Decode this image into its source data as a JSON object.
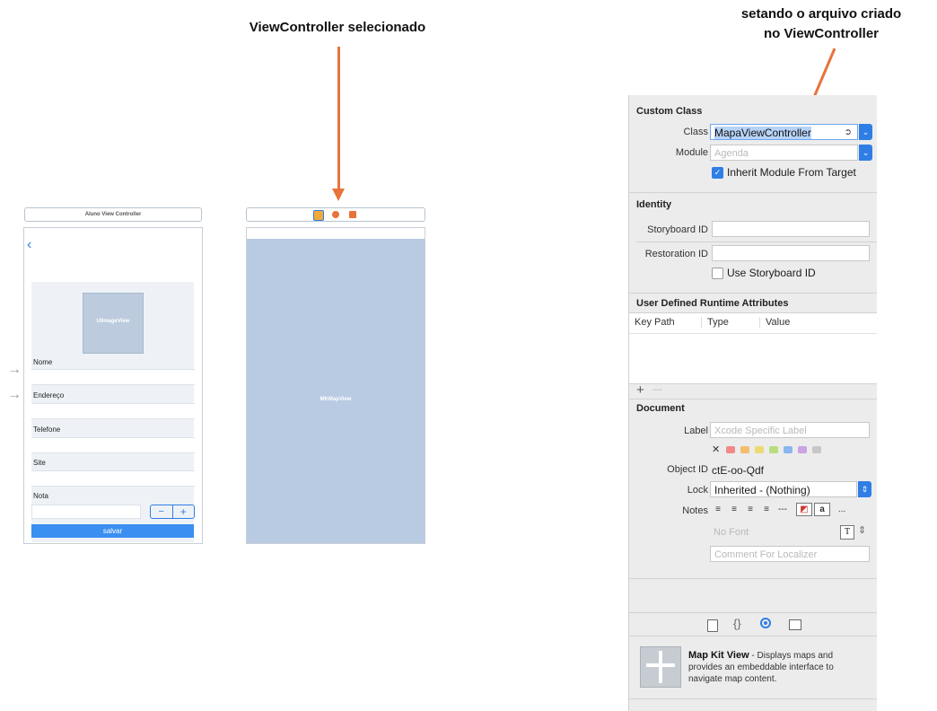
{
  "annotations": {
    "left": "ViewController selecionado",
    "right_line1": "setando o arquivo criado",
    "right_line2": "no ViewController"
  },
  "storyboard": {
    "scene1": {
      "title": "Aluno View Controller",
      "back_icon": "chevron-left-icon",
      "image_view_label": "UIImageView",
      "fields": [
        "Nome",
        "Endereço",
        "Telefone",
        "Site",
        "Nota"
      ],
      "stepper_minus": "−",
      "stepper_plus": "+",
      "save_label": "salvar"
    },
    "scene2": {
      "map_label": "MKMapView"
    }
  },
  "inspector": {
    "custom_class": {
      "header": "Custom Class",
      "class_label": "Class",
      "class_value": "MapaViewController",
      "module_label": "Module",
      "module_placeholder": "Agenda",
      "inherit_label": "Inherit Module From Target",
      "inherit_checked": true
    },
    "identity": {
      "header": "Identity",
      "storyboard_id_label": "Storyboard ID",
      "storyboard_id_value": "",
      "restoration_id_label": "Restoration ID",
      "restoration_id_value": "",
      "use_storyboard_label": "Use Storyboard ID"
    },
    "runtime_attrs": {
      "header": "User Defined Runtime Attributes",
      "columns": [
        "Key Path",
        "Type",
        "Value"
      ],
      "add": "+",
      "remove": "—"
    },
    "document": {
      "header": "Document",
      "label_label": "Label",
      "label_placeholder": "Xcode Specific Label",
      "clear_mark": "✕",
      "swatches": [
        "#f08a8a",
        "#f5bd6b",
        "#eed874",
        "#b7dd7e",
        "#8bb6ee",
        "#c9a3e3",
        "#c7c7c7"
      ],
      "object_id_label": "Object ID",
      "object_id_value": "ctE-oo-Qdf",
      "lock_label": "Lock",
      "lock_value": "Inherited - (Nothing)",
      "notes_label": "Notes",
      "notes_toolbar": [
        "≡",
        "≡",
        "≡",
        "≡",
        "---",
        "◩",
        "a",
        "..."
      ],
      "font_placeholder": "No Font",
      "font_button": "T",
      "comment_placeholder": "Comment For Localizer"
    },
    "tabs": [
      "file-icon",
      "braces-icon",
      "circle-target-icon",
      "panel-icon"
    ],
    "library_item": {
      "title": "Map Kit View",
      "description": " - Displays maps and provides an embeddable interface to navigate map content."
    }
  }
}
